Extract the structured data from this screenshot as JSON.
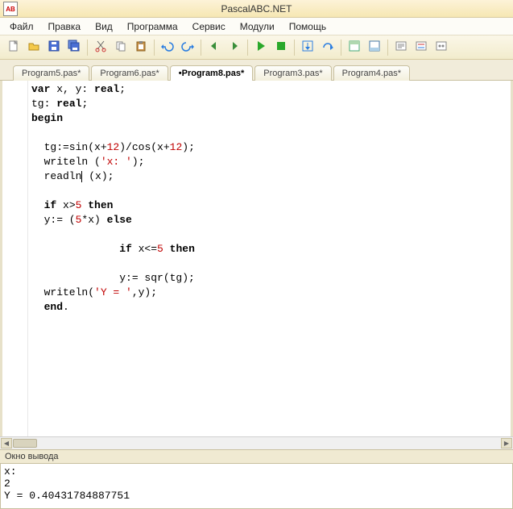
{
  "app": {
    "title": "PascalABC.NET",
    "icon_text": "AB"
  },
  "menu": {
    "items": [
      "Файл",
      "Правка",
      "Вид",
      "Программа",
      "Сервис",
      "Модули",
      "Помощь"
    ]
  },
  "toolbar": {
    "names": [
      "new-file",
      "open-file",
      "save-file",
      "save-all",
      "cut",
      "copy",
      "paste",
      "undo",
      "redo",
      "nav-back",
      "nav-forward",
      "run",
      "stop",
      "step-into",
      "step-over",
      "toggle-panel",
      "toggle-output",
      "find",
      "replace",
      "options"
    ]
  },
  "tabs": [
    {
      "label": "Program5.pas*",
      "active": false
    },
    {
      "label": "Program6.pas*",
      "active": false
    },
    {
      "label": "•Program8.pas*",
      "active": true
    },
    {
      "label": "Program3.pas*",
      "active": false
    },
    {
      "label": "Program4.pas*",
      "active": false
    }
  ],
  "code": {
    "lines": [
      [
        {
          "t": "kw",
          "v": "var"
        },
        {
          "t": "p",
          "v": " x, y: "
        },
        {
          "t": "kw",
          "v": "real"
        },
        {
          "t": "p",
          "v": ";"
        }
      ],
      [
        {
          "t": "p",
          "v": "tg: "
        },
        {
          "t": "kw",
          "v": "real"
        },
        {
          "t": "p",
          "v": ";"
        }
      ],
      [
        {
          "t": "kw",
          "v": "begin"
        }
      ],
      [],
      [
        {
          "t": "p",
          "v": "  tg:=sin(x+"
        },
        {
          "t": "num",
          "v": "12"
        },
        {
          "t": "p",
          "v": ")/cos(x+"
        },
        {
          "t": "num",
          "v": "12"
        },
        {
          "t": "p",
          "v": ");"
        }
      ],
      [
        {
          "t": "p",
          "v": "  writeln ("
        },
        {
          "t": "str",
          "v": "'x: '"
        },
        {
          "t": "p",
          "v": ");"
        }
      ],
      [
        {
          "t": "p",
          "v": "  readln"
        },
        {
          "t": "caret",
          "v": ""
        },
        {
          "t": "p",
          "v": " (x);"
        }
      ],
      [],
      [
        {
          "t": "p",
          "v": "  "
        },
        {
          "t": "kw",
          "v": "if"
        },
        {
          "t": "p",
          "v": " x>"
        },
        {
          "t": "num",
          "v": "5"
        },
        {
          "t": "p",
          "v": " "
        },
        {
          "t": "kw",
          "v": "then"
        }
      ],
      [
        {
          "t": "p",
          "v": "  y:= ("
        },
        {
          "t": "num",
          "v": "5"
        },
        {
          "t": "p",
          "v": "*x) "
        },
        {
          "t": "kw",
          "v": "else"
        }
      ],
      [],
      [
        {
          "t": "p",
          "v": "              "
        },
        {
          "t": "kw",
          "v": "if"
        },
        {
          "t": "p",
          "v": " x<="
        },
        {
          "t": "num",
          "v": "5"
        },
        {
          "t": "p",
          "v": " "
        },
        {
          "t": "kw",
          "v": "then"
        }
      ],
      [],
      [
        {
          "t": "p",
          "v": "              y:= sqr(tg);"
        }
      ],
      [
        {
          "t": "p",
          "v": "  writeln("
        },
        {
          "t": "str",
          "v": "'Y = '"
        },
        {
          "t": "p",
          "v": ",y);"
        }
      ],
      [
        {
          "t": "p",
          "v": "  "
        },
        {
          "t": "kw",
          "v": "end"
        },
        {
          "t": "p",
          "v": "."
        }
      ]
    ]
  },
  "output": {
    "title": "Окно вывода",
    "text": "x:\n2\nY = 0.40431784887751"
  }
}
